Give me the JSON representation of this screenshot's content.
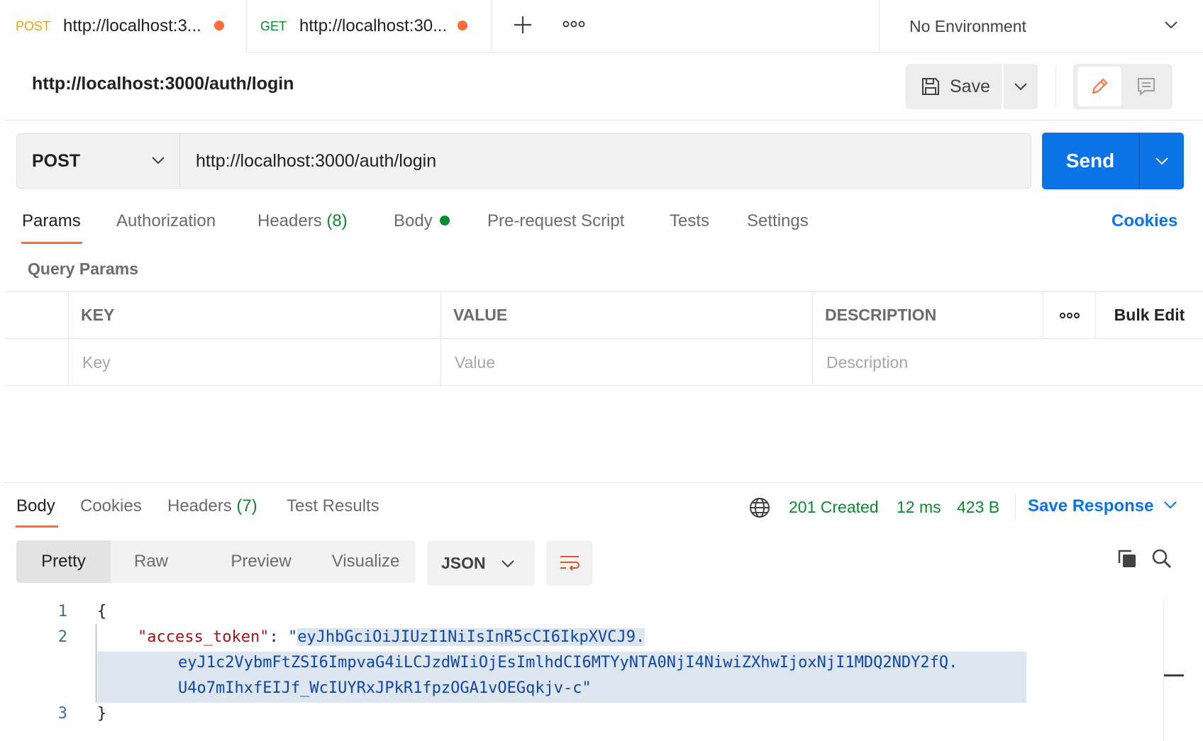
{
  "tabs": [
    {
      "method": "POST",
      "method_color": "#f0a019",
      "url": "http://localhost:3..."
    },
    {
      "method": "GET",
      "method_color": "#0c8a2f",
      "url": "http://localhost:30..."
    }
  ],
  "environment": "No Environment",
  "request": {
    "title": "http://localhost:3000/auth/login",
    "save_label": "Save",
    "method": "POST",
    "url": "http://localhost:3000/auth/login",
    "send_label": "Send"
  },
  "request_tabs": {
    "params": "Params",
    "authorization": "Authorization",
    "headers": "Headers",
    "headers_count": "(8)",
    "body": "Body",
    "pre_request": "Pre-request Script",
    "tests": "Tests",
    "settings": "Settings",
    "cookies": "Cookies"
  },
  "query_params": {
    "title": "Query Params",
    "columns": [
      "KEY",
      "VALUE",
      "DESCRIPTION"
    ],
    "bulk_edit": "Bulk Edit",
    "placeholders": {
      "key": "Key",
      "value": "Value",
      "description": "Description"
    }
  },
  "response": {
    "tabs": {
      "body": "Body",
      "cookies": "Cookies",
      "headers": "Headers",
      "headers_count": "(7)",
      "test_results": "Test Results"
    },
    "status": "201 Created",
    "time": "12 ms",
    "size": "423 B",
    "save_response": "Save Response",
    "formats": {
      "pretty": "Pretty",
      "raw": "Raw",
      "preview": "Preview",
      "visualize": "Visualize"
    },
    "language": "JSON",
    "lines": {
      "n1": "1",
      "n2": "2",
      "n3": "3",
      "open_brace": "{",
      "key": "\"access_token\"",
      "colon": ": ",
      "quote_open": "\"",
      "token_part1": "eyJhbGciOiJIUzI1NiIsInR5cCI6IkpXVCJ9.",
      "token_part2": "eyJ1c2VybmFtZSI6ImpvaG4iLCJzdWIiOjEsImlhdCI6MTYyNTA0NjI4NiwiZXhwIjoxNjI1MDQ2NDY2fQ.",
      "token_part3": "U4o7mIhxfEIJf_WcIUYRxJPkR1fpzOGA1vOEGqkjv-c",
      "quote_close": "\"",
      "close_brace": "}"
    }
  },
  "colors": {
    "accent": "#ff6c37",
    "primary": "#0c73e6",
    "success": "#0c8a2f"
  }
}
